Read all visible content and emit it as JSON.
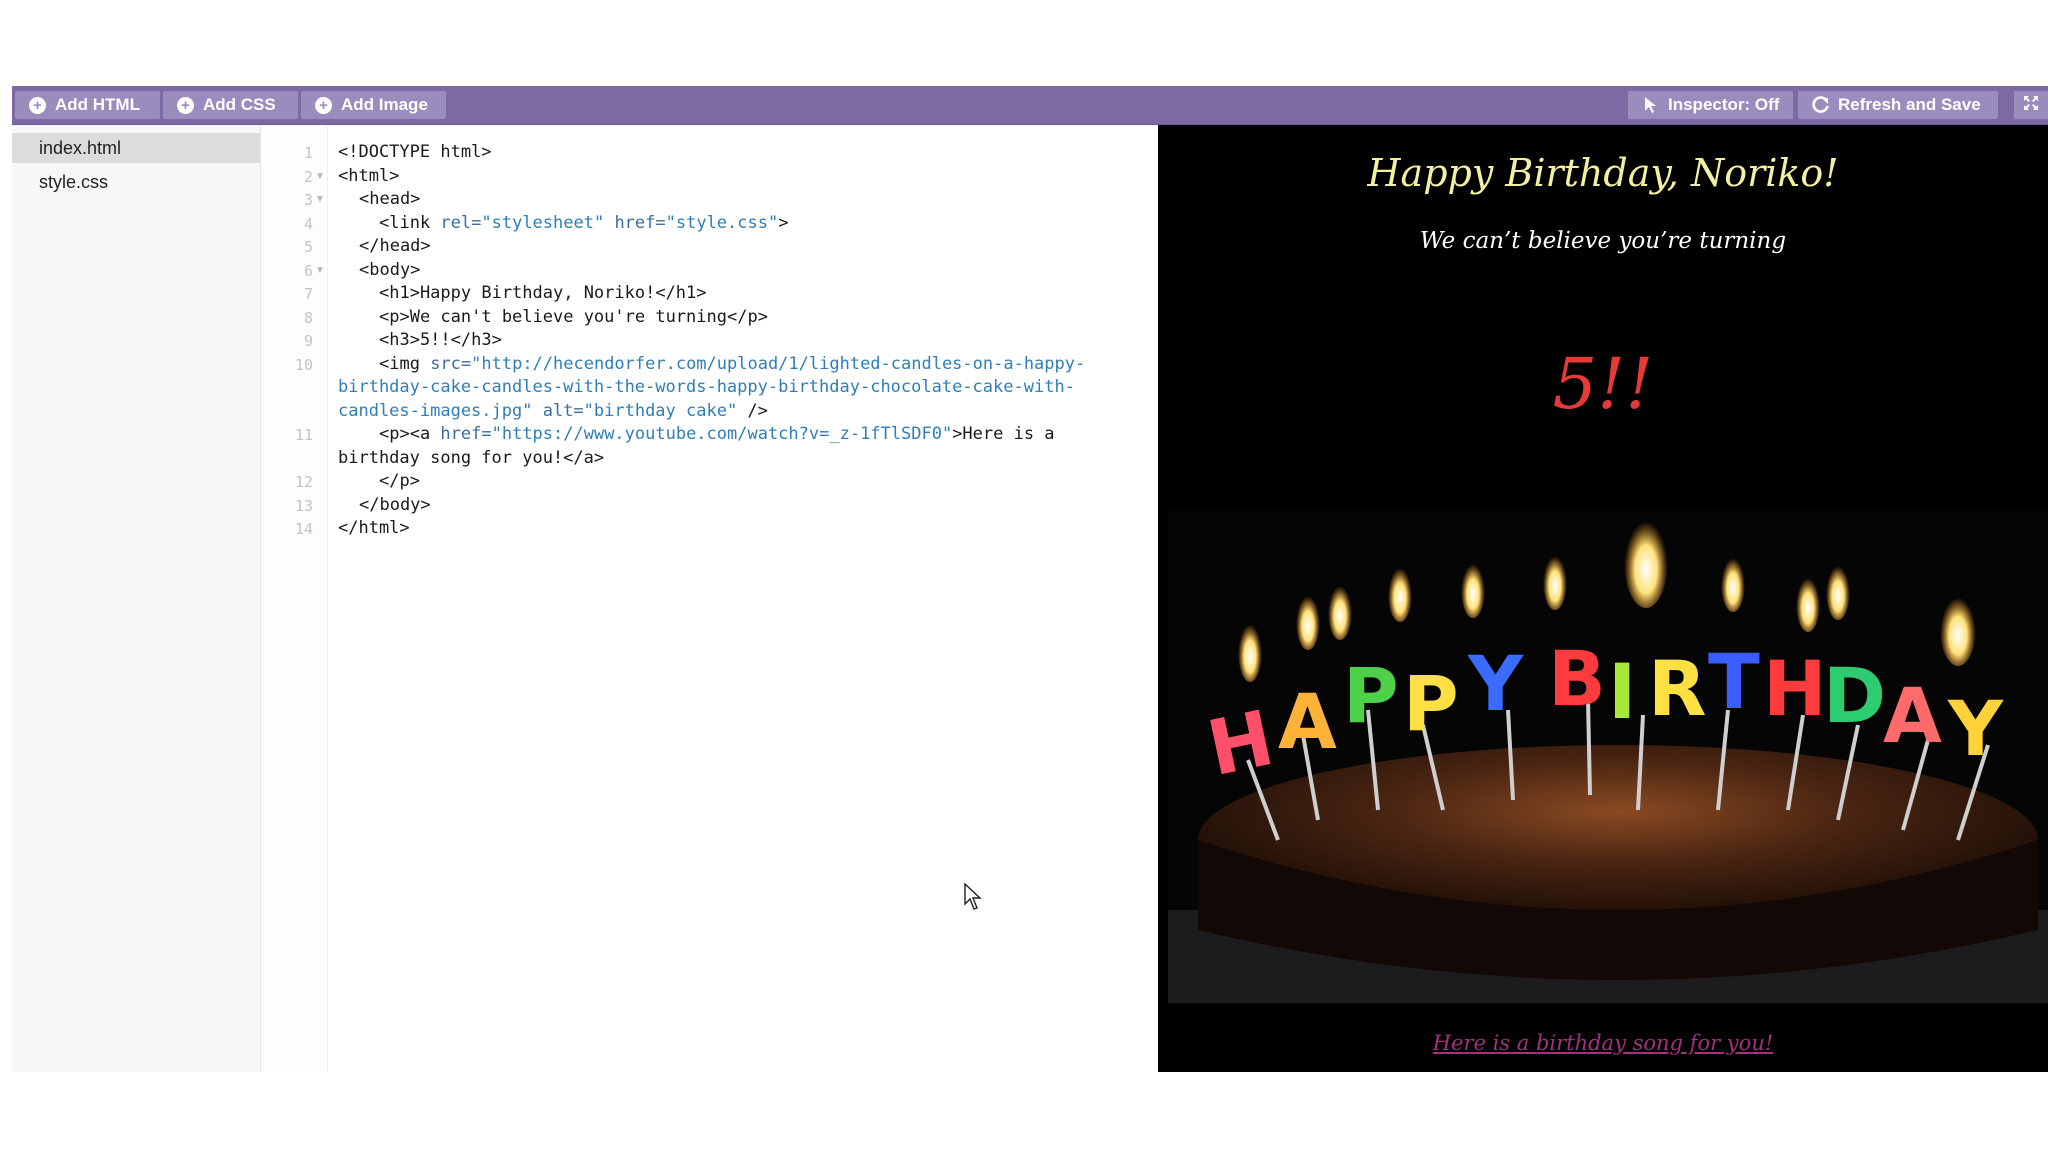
{
  "toolbar": {
    "add_html": "Add HTML",
    "add_css": "Add CSS",
    "add_image": "Add Image",
    "inspector": "Inspector: Off",
    "refresh_save": "Refresh and Save"
  },
  "files": [
    "index.html",
    "style.css"
  ],
  "active_file": "index.html",
  "editor": {
    "line_numbers": [
      "1",
      "2",
      "3",
      "4",
      "5",
      "6",
      "7",
      "8",
      "9",
      "10",
      "11",
      "12",
      "13",
      "14"
    ],
    "lines": {
      "l1": "<!DOCTYPE html>",
      "l2": "<html>",
      "l3": "<head>",
      "l4_a": "<link ",
      "l4_b": "rel=",
      "l4_c": "\"stylesheet\"",
      "l4_d": " href=",
      "l4_e": "\"style.css\"",
      "l4_f": ">",
      "l5": "</head>",
      "l6": "<body>",
      "l7": "<h1>Happy Birthday, Noriko!</h1>",
      "l8": "<p>We can't believe you're turning</p>",
      "l9": "<h3>5!!</h3>",
      "l10_a": "<img ",
      "l10_b": "src=",
      "l10_c": "\"http://hecendorfer.com/upload/1/lighted-candles-on-a-happy-",
      "l10_d": "birthday-cake-candles-with-the-words-happy-birthday-chocolate-cake-with-",
      "l10_e": "candles-images.jpg\"",
      "l10_f": " alt=",
      "l10_g": "\"birthday cake\"",
      "l10_h": " />",
      "l11_a": "<p><a ",
      "l11_b": "href=",
      "l11_c": "\"https://www.youtube.com/watch?v=_z-1fTlSDF0\"",
      "l11_d": ">Here is a",
      "l11_e": "birthday song for you!</a>",
      "l12": "</p>",
      "l13": "</body>",
      "l14": "</html>"
    }
  },
  "preview": {
    "title": "Happy Birthday, Noriko!",
    "subtitle": "We can’t believe you’re turning",
    "number": "5!!",
    "link": "Here is a birthday song for you!",
    "colors": {
      "background": "#000000",
      "title": "#f3f0a0",
      "number": "#e63a37",
      "link": "#a5307e"
    }
  },
  "colors": {
    "toolbar": "#7b6aa4",
    "toolbar_button": "#9a8dbe"
  },
  "icons": [
    "plus-circle-icon",
    "pointer-icon",
    "refresh-icon",
    "expand-icon",
    "mouse-cursor-icon"
  ]
}
